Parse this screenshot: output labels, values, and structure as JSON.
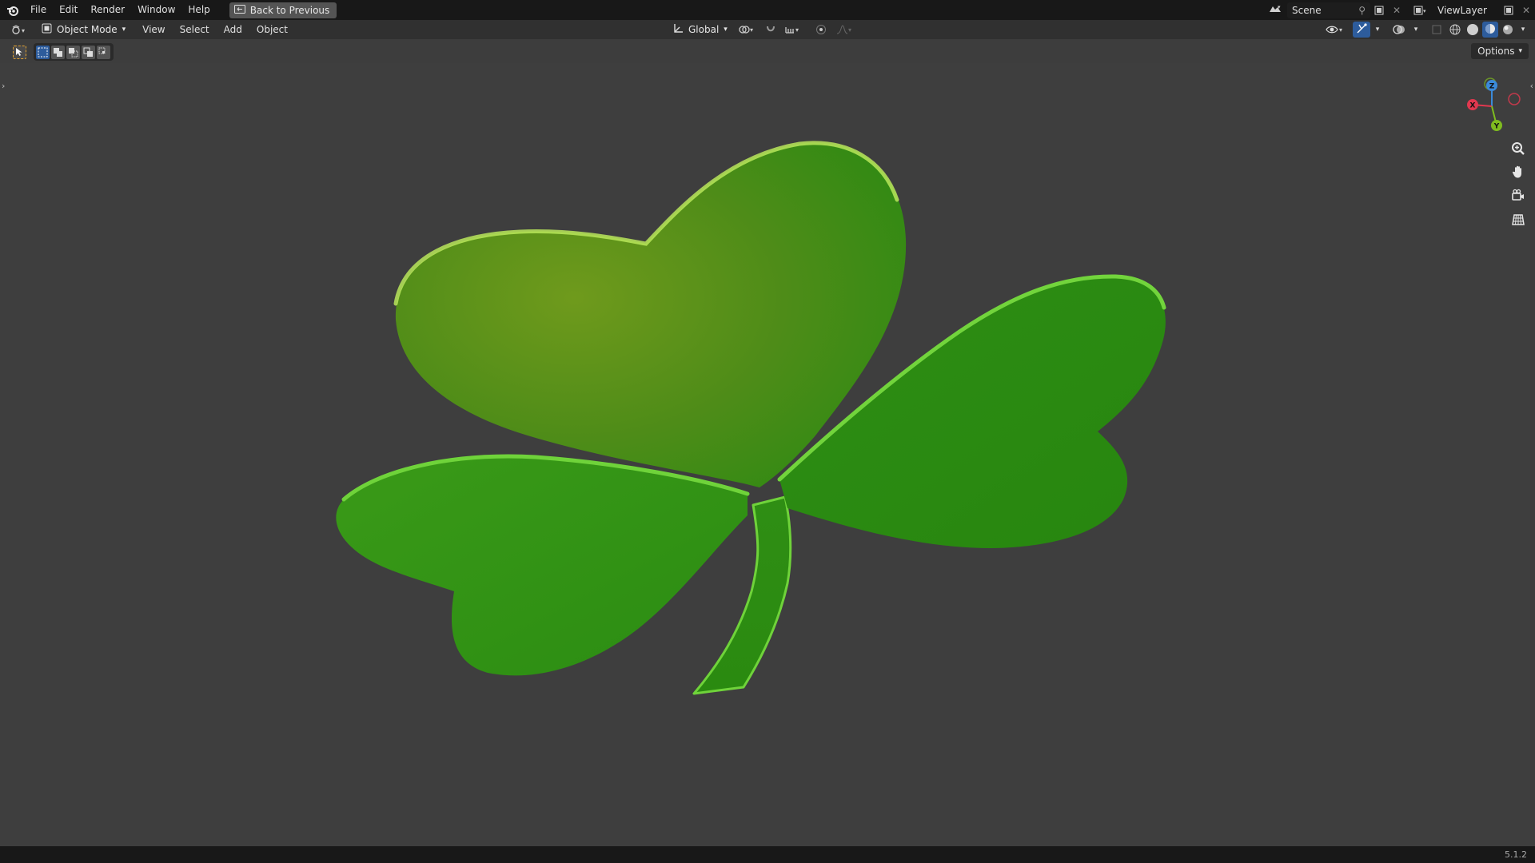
{
  "menubar": {
    "items": [
      "File",
      "Edit",
      "Render",
      "Window",
      "Help"
    ],
    "back_button": "Back to Previous",
    "scene": "Scene",
    "view_layer": "ViewLayer"
  },
  "header": {
    "mode": "Object Mode",
    "menus": [
      "View",
      "Select",
      "Add",
      "Object"
    ],
    "orientation": "Global"
  },
  "toolbar": {
    "options_label": "Options"
  },
  "gizmo": {
    "x_label": "X",
    "y_label": "Y",
    "z_label": "Z",
    "colors": {
      "x": "#e2384f",
      "y": "#7fbc1f",
      "z": "#3b8ad9"
    }
  },
  "statusbar": {
    "version": "5.1.2"
  },
  "icons": [
    "blender-logo-icon",
    "back-icon",
    "scene-icon",
    "pin-icon",
    "new-scene-icon",
    "close-icon",
    "view-layer-icon",
    "editor-type-icon",
    "object-mode-icon",
    "transform-pivot-icon",
    "snap-icon",
    "proportional-edit-icon",
    "visibility-icon",
    "gizmo-icon",
    "overlay-icon",
    "xray-icon",
    "wireframe-icon",
    "solid-icon",
    "material-icon",
    "rendered-icon",
    "select-cursor-icon",
    "zoom-icon",
    "hand-pan-icon",
    "camera-icon",
    "grid-icon"
  ]
}
